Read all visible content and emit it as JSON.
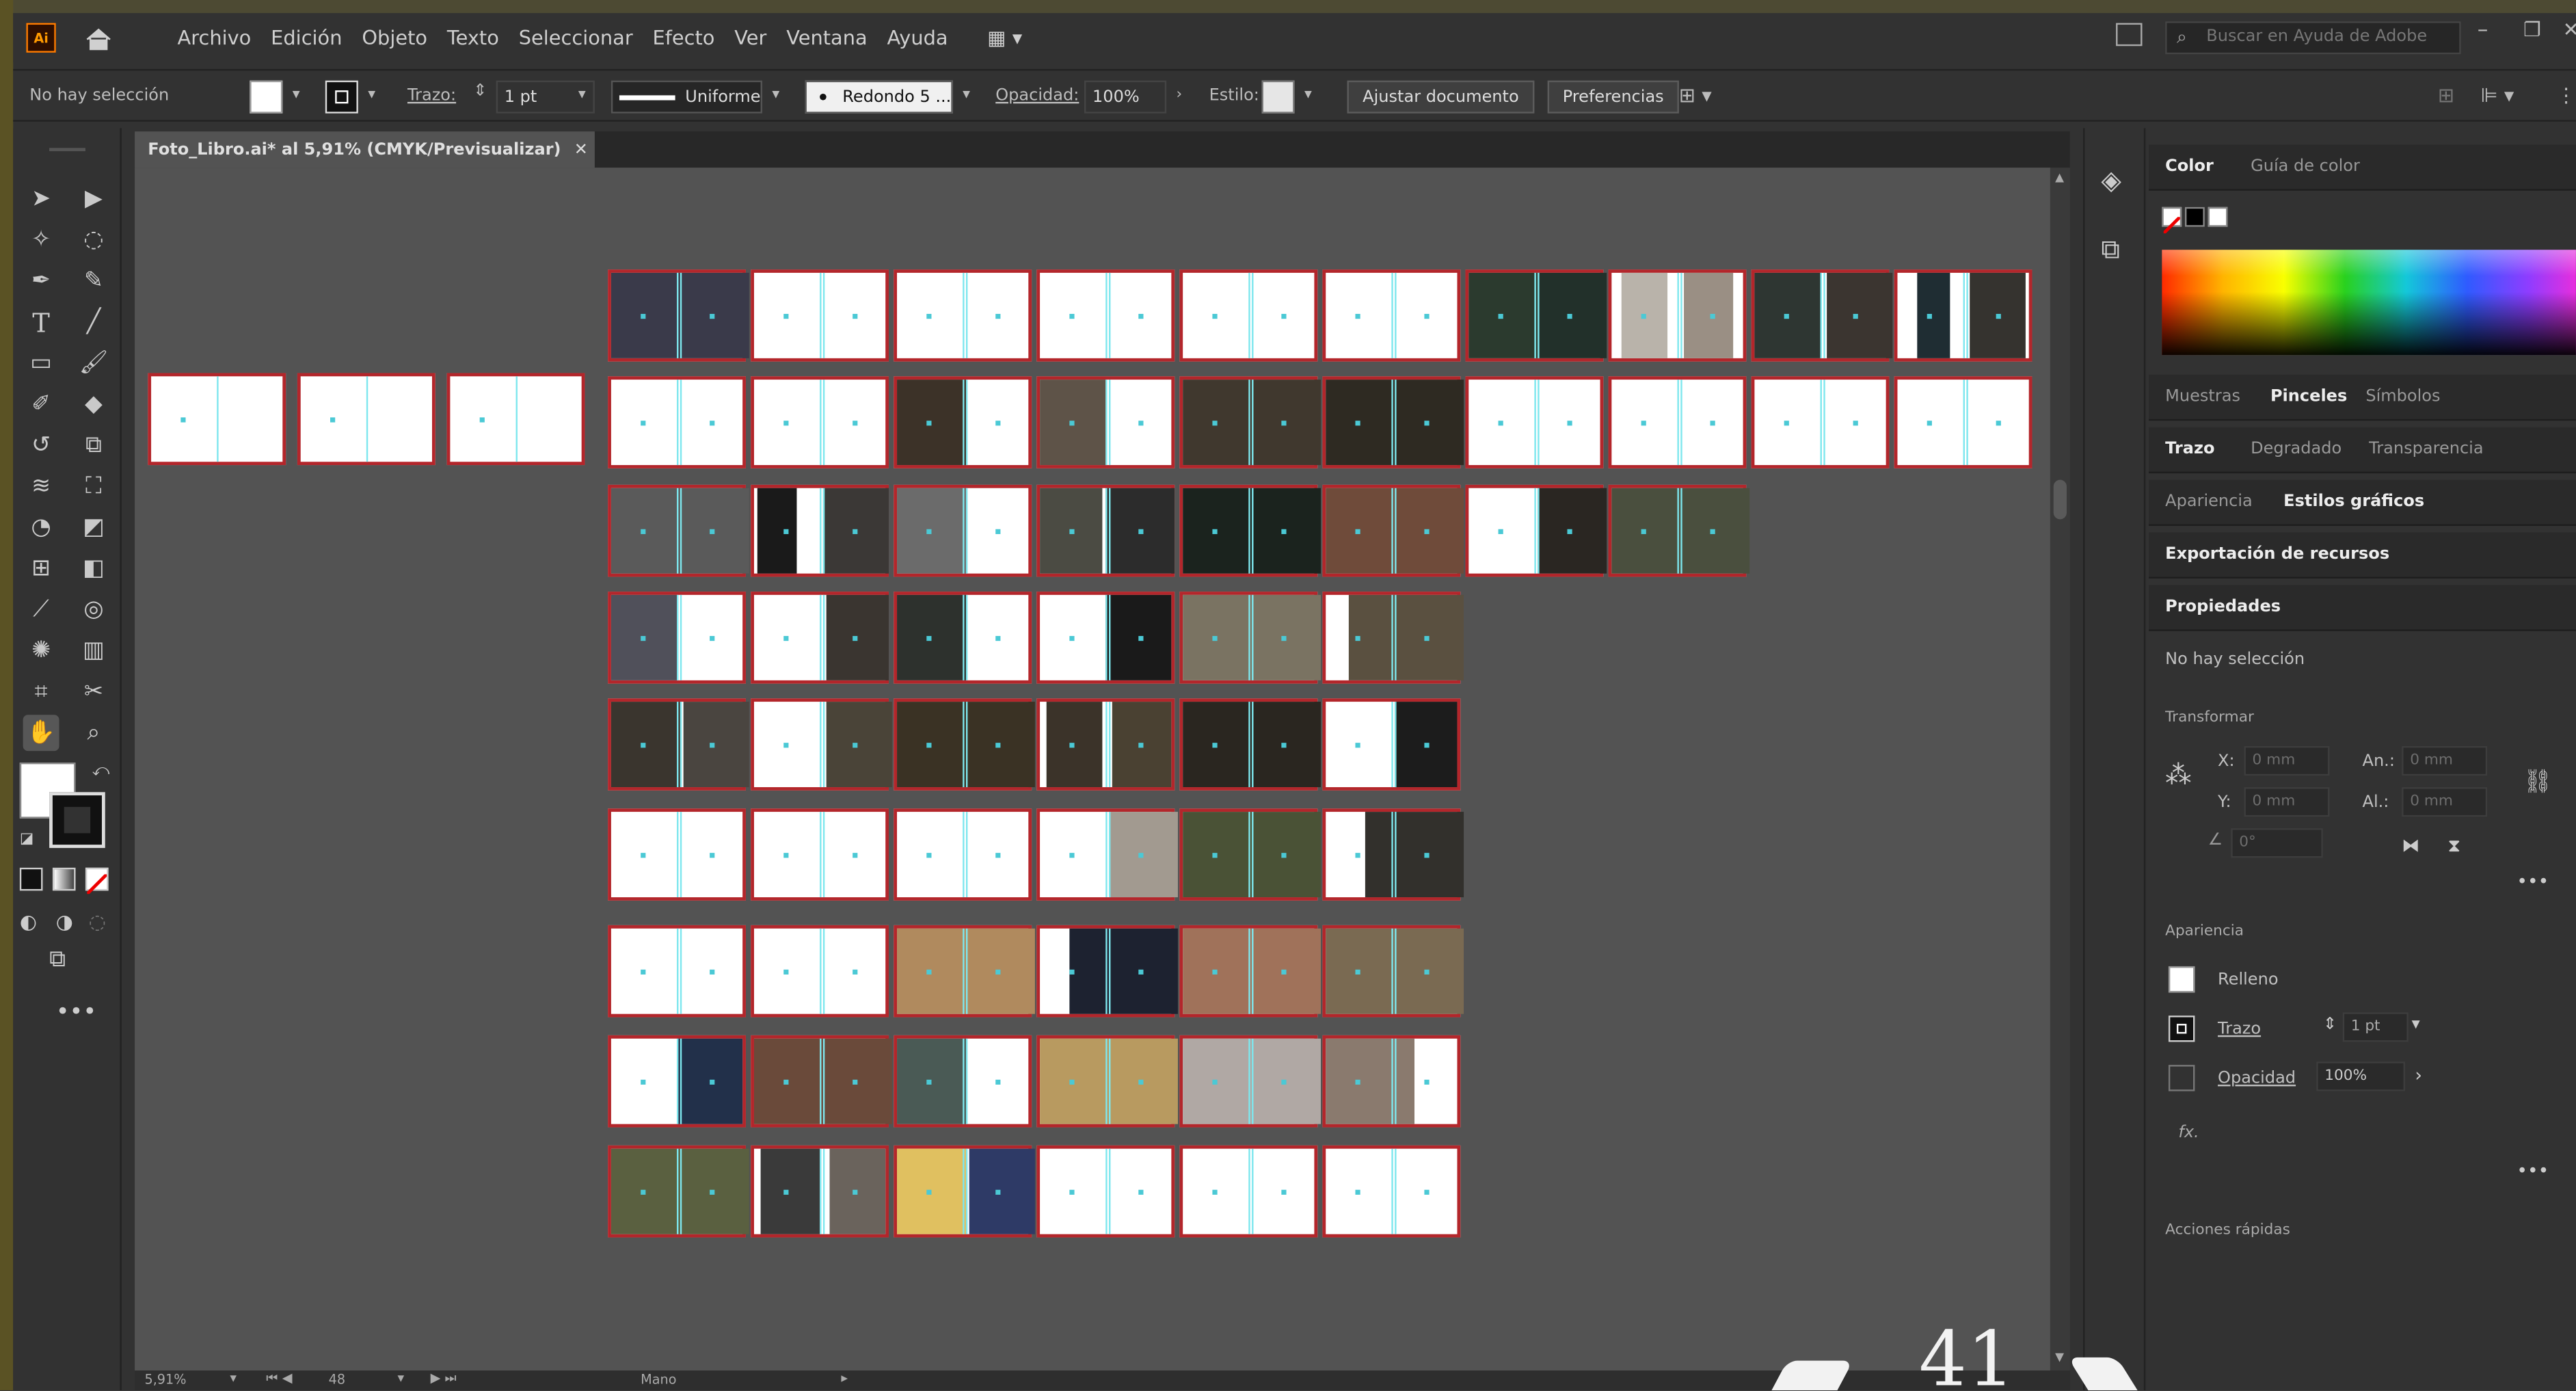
{
  "menu": {
    "app_logo": "Ai",
    "items": [
      "Archivo",
      "Edición",
      "Objeto",
      "Texto",
      "Seleccionar",
      "Efecto",
      "Ver",
      "Ventana",
      "Ayuda"
    ],
    "search_placeholder": "Buscar en Ayuda de Adobe"
  },
  "control_bar": {
    "selection_status": "No hay selección",
    "stroke_label": "Trazo:",
    "stroke_weight": "1 pt",
    "stroke_profile": "Uniforme",
    "brush": "Redondo 5 ...",
    "opacity_label": "Opacidad:",
    "opacity_value": "100%",
    "style_label": "Estilo:",
    "document_setup_button": "Ajustar documento",
    "preferences_button": "Preferencias"
  },
  "document": {
    "tab_title": "Foto_Libro.ai* al 5,91% (CMYK/Previsualizar)",
    "zoom": "5,91%",
    "artboard_number": "48",
    "tool_status": "Mano"
  },
  "panels": {
    "color_tabs": [
      "Color",
      "Guía de color"
    ],
    "brush_tabs": [
      "Muestras",
      "Pinceles",
      "Símbolos"
    ],
    "stroke_tabs": [
      "Trazo",
      "Degradado",
      "Transparencia"
    ],
    "appearance_tabs": [
      "Apariencia",
      "Estilos gráficos"
    ],
    "asset_export": "Exportación de recursos",
    "properties_tab": "Propiedades",
    "no_selection": "No hay selección",
    "transform_heading": "Transformar",
    "x_label": "X:",
    "y_label": "Y:",
    "w_label": "An.:",
    "h_label": "Al.:",
    "field_value": "0 mm",
    "angle_value": "0°",
    "appearance_heading": "Apariencia",
    "fill_label": "Relleno",
    "stroke_label": "Trazo",
    "stroke_weight": "1 pt",
    "opacity_label": "Opacidad",
    "opacity_value": "100%",
    "fx_label": "fx.",
    "quick_actions": "Acciones rápidas"
  },
  "page_number": "41",
  "colors": {
    "artboard_border": "#b3262b",
    "guide": "#7ee7ee",
    "canvas": "#535353",
    "panel_bg": "#323232"
  },
  "icons": [
    "home-icon",
    "selection-tool-icon",
    "direct-selection-tool-icon",
    "magic-wand-icon",
    "lasso-icon",
    "pen-icon",
    "curvature-icon",
    "type-icon",
    "line-icon",
    "rectangle-icon",
    "paintbrush-icon",
    "shaper-icon",
    "eraser-icon",
    "rotate-icon",
    "scale-icon",
    "warp-icon",
    "free-transform-icon",
    "shape-builder-icon",
    "live-paint-icon",
    "perspective-grid-icon",
    "mesh-icon",
    "gradient-icon",
    "eyedropper-icon",
    "blend-icon",
    "symbol-sprayer-icon",
    "column-graph-icon",
    "artboard-icon",
    "slice-icon",
    "hand-icon",
    "zoom-icon",
    "layers-icon",
    "artboards-panel-icon",
    "search-icon",
    "minimize-icon",
    "restore-icon",
    "close-icon",
    "more-icon"
  ]
}
